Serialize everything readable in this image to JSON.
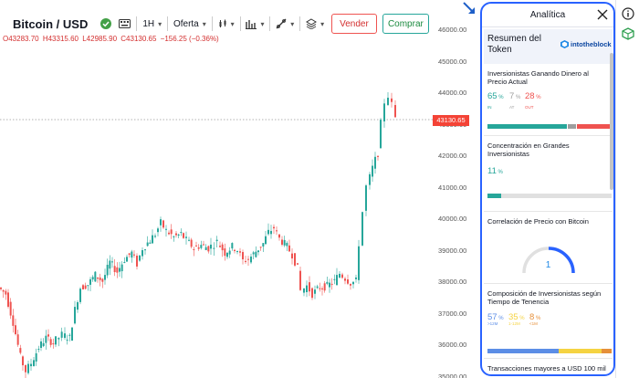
{
  "toolbar": {
    "symbol": "Bitcoin / USD",
    "interval": "1H",
    "offer": "Oferta",
    "sell_label": "Vender",
    "buy_label": "Comprar"
  },
  "ohlc": {
    "open": "O43283.70",
    "high": "H43315.60",
    "low": "L42985.90",
    "close": "C43130.65",
    "change": "−156.25 (−0.36%)"
  },
  "price_axis": [
    "46000.00",
    "45000.00",
    "44000.00",
    "43000.00",
    "42000.00",
    "41000.00",
    "40000.00",
    "39000.00",
    "38000.00",
    "37000.00",
    "36000.00",
    "35000.00"
  ],
  "last_price": "43130.65",
  "colors": {
    "up": "#26a69a",
    "down": "#ef5350",
    "accent": "#2962ff",
    "in": "#26a69a",
    "at": "#9e9e9e",
    "out": "#ef5350"
  },
  "panel": {
    "title": "Analítica",
    "summary_title": "Resumen del Token",
    "logo_text": "intotheblock",
    "cards": {
      "investors": {
        "title": "Inversionistas Ganando Dinero al Precio Actual",
        "in_pct": "65",
        "at_pct": "7",
        "out_pct": "28",
        "in_label": "IN",
        "at_label": "AT",
        "out_label": "OUT",
        "in_value": 65,
        "at_value": 7,
        "out_value": 28
      },
      "concentration": {
        "title": "Concentración en Grandes Inversionistas",
        "pct": "11",
        "value": 11
      },
      "correlation": {
        "title": "Correlación de Precio con Bitcoin",
        "value": "1",
        "level": 0.25
      },
      "composition": {
        "title": "Composición de Inversionistas según Tiempo de Tenencia",
        "a_pct": "57",
        "b_pct": "35",
        "c_pct": "8",
        "a_label": ">12M",
        "b_label": "1-12M",
        "c_label": "<1M",
        "a_value": 57,
        "b_value": 35,
        "c_value": 8
      },
      "transactions": {
        "title": "Transacciones mayores a USD 100 mil"
      }
    }
  }
}
